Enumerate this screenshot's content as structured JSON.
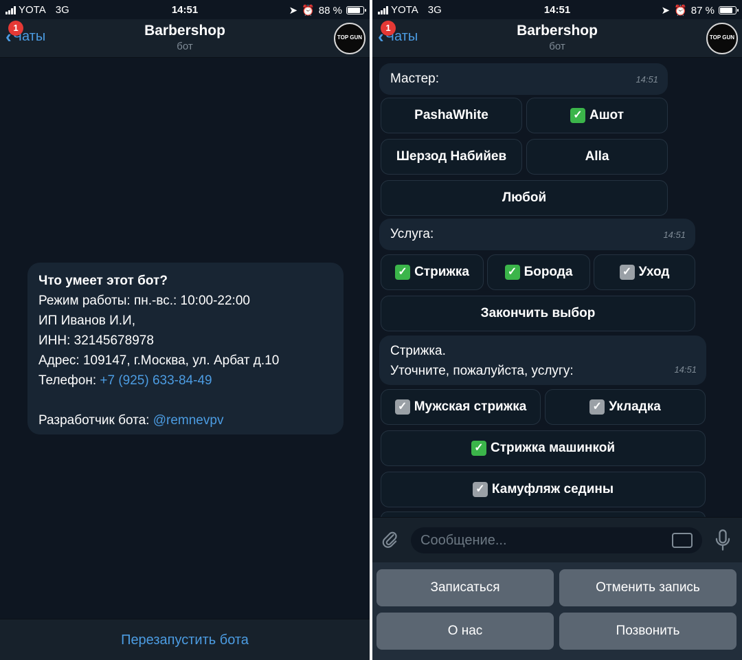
{
  "status_left": {
    "carrier": "YOTA",
    "network": "3G",
    "time": "14:51",
    "battery": "88 %",
    "battery_level": 0.88
  },
  "status_right": {
    "carrier": "YOTA",
    "network": "3G",
    "time": "14:51",
    "battery": "87 %",
    "battery_level": 0.87
  },
  "nav": {
    "back_label": "Чаты",
    "badge": "1",
    "title": "Barbershop",
    "subtitle": "бот",
    "avatar_text": "TOP GUN"
  },
  "bot_info": {
    "title": "Что умеет этот бот?",
    "hours": "Режим работы: пн.-вс.: 10:00-22:00",
    "owner": "ИП Иванов И.И,",
    "inn": "ИНН: 32145678978",
    "address": "Адрес: 109147, г.Москва, ул. Арбат д.10",
    "phone_label": "Телефон: ",
    "phone": "+7 (925) 633-84-49",
    "dev_label": "Разработчик бота: ",
    "dev_link": "@remnevpv"
  },
  "restart_button": "Перезапустить бота",
  "chat": {
    "master": {
      "text": "Мастер:",
      "time": "14:51"
    },
    "master_buttons": [
      {
        "label": "PashaWhite",
        "checked": false
      },
      {
        "label": "Ашот",
        "checked": true
      },
      {
        "label": "Шерзод Набийев",
        "checked": false
      },
      {
        "label": "Alla",
        "checked": false
      },
      {
        "label": "Любой",
        "checked": false
      }
    ],
    "service": {
      "text": "Услуга:",
      "time": "14:51"
    },
    "service_buttons": [
      {
        "label": "Стрижка",
        "state": "on"
      },
      {
        "label": "Борода",
        "state": "on"
      },
      {
        "label": "Уход",
        "state": "off"
      }
    ],
    "finish_button": "Закончить выбор",
    "clarify": {
      "line1": "Стрижка.",
      "line2": "Уточните, пожалуйста, услугу:",
      "time": "14:51"
    },
    "haircut_buttons": [
      {
        "label": "Мужская стрижка",
        "state": "off"
      },
      {
        "label": "Укладка",
        "state": "off"
      },
      {
        "label": "Стрижка машинкой",
        "state": "on"
      },
      {
        "label": "Камуфляж седины",
        "state": "off"
      }
    ]
  },
  "input": {
    "placeholder": "Сообщение..."
  },
  "reply_keyboard": [
    "Записаться",
    "Отменить запись",
    "О нас",
    "Позвонить"
  ],
  "icons": [
    "chevron-left-icon",
    "location-icon",
    "alarm-icon",
    "paperclip-icon",
    "keyboard-icon",
    "microphone-icon",
    "checkbox-checked-icon",
    "checkbox-grey-icon"
  ],
  "colors": {
    "background": "#0e1621",
    "bar": "#17212b",
    "bubble": "#182533",
    "accent": "#4c9ce2",
    "check_green": "#3bb54a",
    "reply_button": "#5b6672"
  }
}
